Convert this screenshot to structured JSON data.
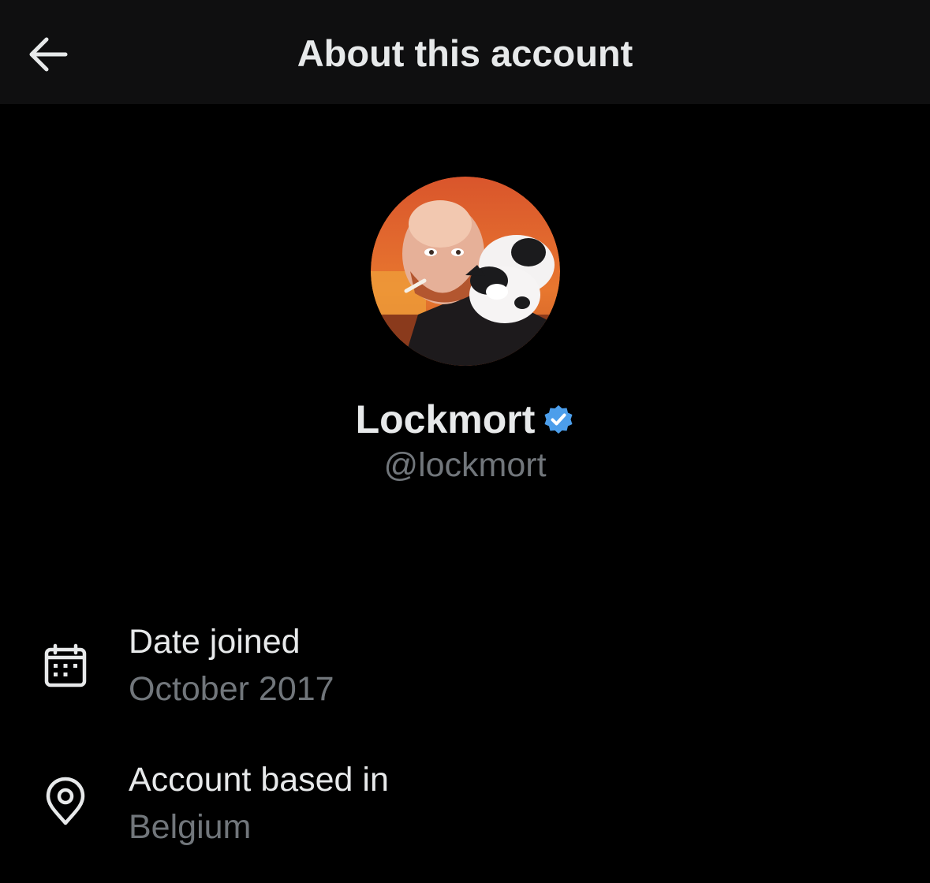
{
  "header": {
    "title": "About this account",
    "back_icon": "arrow-left-icon"
  },
  "profile": {
    "display_name": "Lockmort",
    "verified": true,
    "verified_icon": "verified-badge-icon",
    "verified_color": "#4c9eeb",
    "handle": "@lockmort"
  },
  "details": [
    {
      "icon": "calendar-icon",
      "label": "Date joined",
      "value": "October 2017"
    },
    {
      "icon": "location-pin-icon",
      "label": "Account based in",
      "value": "Belgium"
    }
  ],
  "colors": {
    "background": "#000000",
    "header_background": "#0f0f10",
    "primary_text": "#e7e9ea",
    "secondary_text": "#71767b"
  }
}
